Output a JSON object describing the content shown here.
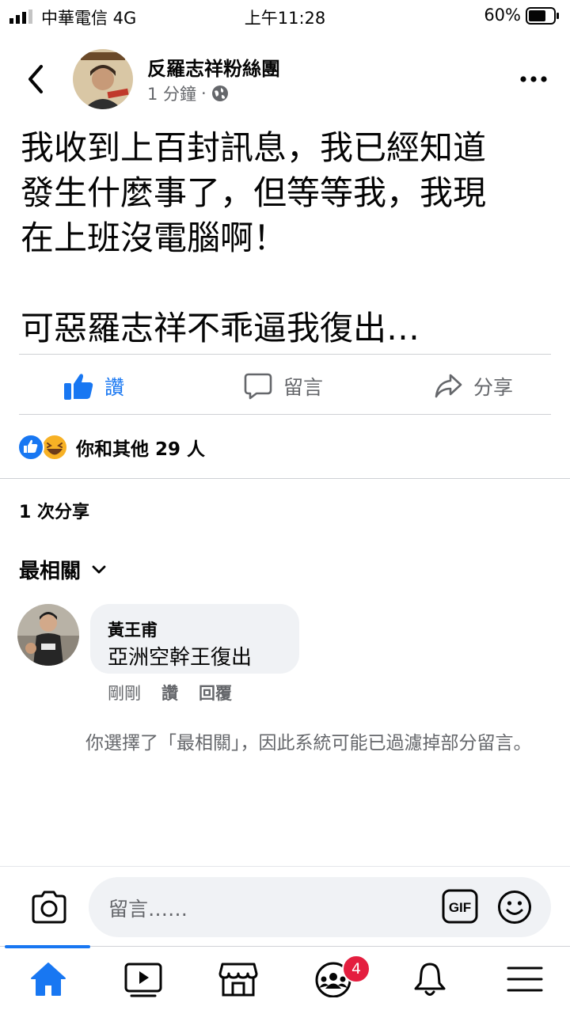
{
  "status_bar": {
    "carrier": "中華電信  4G",
    "time": "上午11:28",
    "battery": "60%"
  },
  "post": {
    "page_name": "反羅志祥粉絲團",
    "time_ago": "1 分鐘",
    "meta_separator": "·",
    "body": "我收到上百封訊息，我已經知道\n發生什麼事了，但等等我，我現\n在上班沒電腦啊！\n\n可惡羅志祥不乖逼我復出…",
    "actions": {
      "like": "讚",
      "comment": "留言",
      "share": "分享"
    },
    "reactions_text": "你和其他 29 人",
    "shares_text": "1 次分享"
  },
  "comments": {
    "sort_label": "最相關",
    "items": [
      {
        "author": "黃王甫",
        "text": "亞洲空幹王復出",
        "time": "剛剛",
        "like": "讚",
        "reply": "回覆"
      }
    ],
    "filter_note": "你選擇了「最相關」，因此系統可能已過濾掉部分留言。"
  },
  "composer": {
    "placeholder": "留言……",
    "gif_label": "GIF"
  },
  "tabbar": {
    "groups_badge": "4",
    "items": [
      "home-tab",
      "watch-tab",
      "marketplace-tab",
      "groups-tab",
      "notifications-tab",
      "menu-tab"
    ]
  },
  "colors": {
    "accent": "#1877f2",
    "secondary_text": "#65676b",
    "badge": "#e41e3f"
  }
}
